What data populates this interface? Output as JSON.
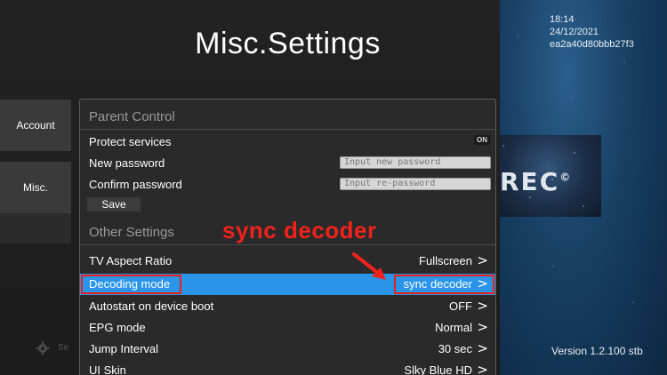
{
  "header": {
    "title": "Misc.Settings"
  },
  "status": {
    "time": "18:14",
    "date": "24/12/2021",
    "device_id": "ea2a40d80bbb27f3"
  },
  "logo": {
    "text": "REC",
    "mark": "©"
  },
  "version": "Version 1.2.100 stb",
  "sidebar": {
    "items": [
      {
        "label": "Account"
      },
      {
        "label": "Misc."
      }
    ],
    "bottom_item": {
      "label": "Se",
      "icon": "gear-icon"
    }
  },
  "parent_control": {
    "title": "Parent Control",
    "protect_services": {
      "label": "Protect services",
      "toggle": "ON"
    },
    "new_password": {
      "label": "New password",
      "placeholder": "Input new password"
    },
    "confirm_password": {
      "label": "Confirm password",
      "placeholder": "Input re-password"
    },
    "save_label": "Save"
  },
  "other_settings": {
    "title": "Other Settings",
    "rows": [
      {
        "label": "TV Aspect Ratio",
        "value": "Fullscreen"
      },
      {
        "label": "Decoding mode",
        "value": "sync decoder"
      },
      {
        "label": "Autostart on device boot",
        "value": "OFF"
      },
      {
        "label": "EPG mode",
        "value": "Normal"
      },
      {
        "label": "Jump Interval",
        "value": "30 sec"
      },
      {
        "label": "UI Skin",
        "value": "Slky Blue HD"
      }
    ],
    "chevron": ">"
  },
  "annotation": {
    "text": "sync decoder"
  },
  "colors": {
    "selected_row": "#2a95e8",
    "annotation_red": "#f0221c",
    "panel_bg": "#2a2a2a",
    "sidebar_bg": "#3a3a3a"
  }
}
